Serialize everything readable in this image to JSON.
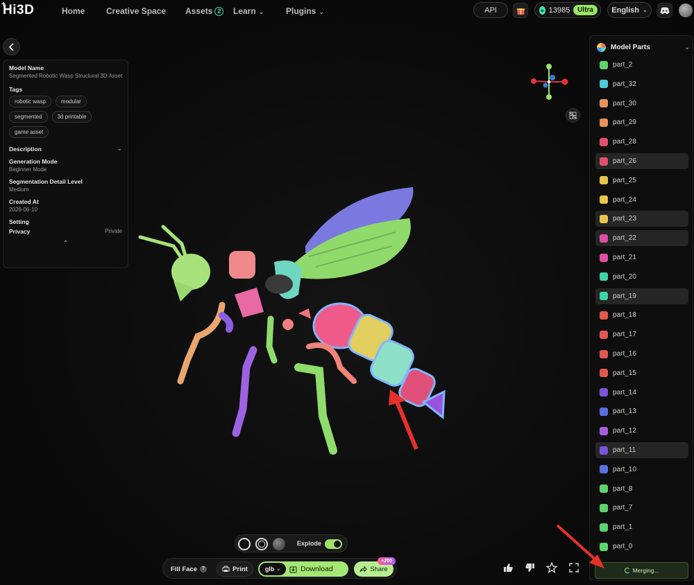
{
  "app": {
    "logo": "Hi3D"
  },
  "nav": {
    "home": "Home",
    "creative_space": "Creative Space",
    "assets": "Assets",
    "assets_badge": "2",
    "learn": "Learn",
    "plugins": "Plugins"
  },
  "topright": {
    "api": "API",
    "credits": "13985",
    "plan": "Ultra",
    "language": "English"
  },
  "model_info": {
    "name_label": "Model Name",
    "name": "Segmented Robotic Wasp Structural 3D Asset",
    "tags_label": "Tags",
    "tags": [
      "robotic wasp",
      "modular",
      "segmented",
      "3d printable",
      "game asset"
    ],
    "description_label": "Description",
    "generation_mode_label": "Generation Mode",
    "generation_mode": "Beginner Mode",
    "seg_level_label": "Segmentation Detail Level",
    "seg_level": "Medium",
    "created_label": "Created At",
    "created": "2026-06-10",
    "setting_label": "Setting",
    "privacy_label": "Privacy",
    "privacy": "Private"
  },
  "parts_panel": {
    "title": "Model Parts",
    "parts": [
      {
        "name": "part_2",
        "color": "#5ed36b",
        "selected": false
      },
      {
        "name": "part_32",
        "color": "#4fc9d9",
        "selected": false
      },
      {
        "name": "part_30",
        "color": "#e8935a",
        "selected": false
      },
      {
        "name": "part_29",
        "color": "#e8935a",
        "selected": false
      },
      {
        "name": "part_28",
        "color": "#e0506e",
        "selected": false
      },
      {
        "name": "part_26",
        "color": "#e0506e",
        "selected": true
      },
      {
        "name": "part_25",
        "color": "#e6c54c",
        "selected": false
      },
      {
        "name": "part_24",
        "color": "#e6c54c",
        "selected": false
      },
      {
        "name": "part_23",
        "color": "#e6c54c",
        "selected": true
      },
      {
        "name": "part_22",
        "color": "#dc4fa4",
        "selected": true
      },
      {
        "name": "part_21",
        "color": "#dc4fa4",
        "selected": false
      },
      {
        "name": "part_20",
        "color": "#3fd4a6",
        "selected": false
      },
      {
        "name": "part_19",
        "color": "#3fd4a6",
        "selected": true
      },
      {
        "name": "part_18",
        "color": "#e0584e",
        "selected": false
      },
      {
        "name": "part_17",
        "color": "#e0584e",
        "selected": false
      },
      {
        "name": "part_16",
        "color": "#e0584e",
        "selected": false
      },
      {
        "name": "part_15",
        "color": "#e0584e",
        "selected": false
      },
      {
        "name": "part_14",
        "color": "#7b54dc",
        "selected": false
      },
      {
        "name": "part_13",
        "color": "#5b6ee0",
        "selected": false
      },
      {
        "name": "part_12",
        "color": "#a65ee0",
        "selected": false
      },
      {
        "name": "part_11",
        "color": "#7b54dc",
        "selected": true
      },
      {
        "name": "part_10",
        "color": "#5b6ee0",
        "selected": false
      },
      {
        "name": "part_8",
        "color": "#5ed36b",
        "selected": false
      },
      {
        "name": "part_7",
        "color": "#5ed36b",
        "selected": false
      },
      {
        "name": "part_1",
        "color": "#5ed36b",
        "selected": false
      },
      {
        "name": "part_0",
        "color": "#5ed36b",
        "selected": false
      }
    ],
    "merge_label": "Merging..."
  },
  "viewer_controls": {
    "explode_label": "Explode",
    "explode_on": true
  },
  "actions": {
    "fill_face": "Fill Face",
    "print": "Print",
    "format": "glb",
    "download": "Download",
    "share": "Share",
    "share_badge": "+200"
  },
  "colors": {
    "accent_green": "#a4e776",
    "teal": "#4be3b0"
  }
}
